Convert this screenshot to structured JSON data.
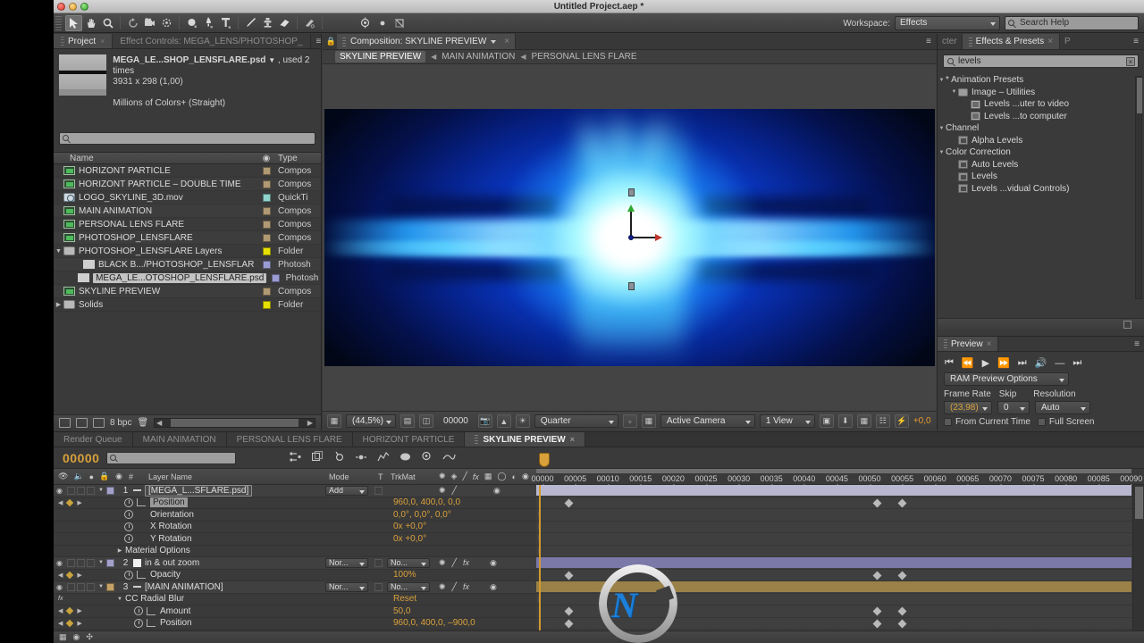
{
  "window": {
    "title": "Untitled Project.aep *"
  },
  "toolbar": {
    "tools": [
      {
        "name": "selection-tool",
        "glyph": "↖",
        "selected": true
      },
      {
        "name": "hand-tool",
        "glyph": "✋",
        "selected": false
      },
      {
        "name": "zoom-tool",
        "glyph": "⌕",
        "selected": false
      },
      {
        "name": "rotation-tool",
        "glyph": "↺",
        "selected": false
      },
      {
        "name": "camera-tool",
        "glyph": "▣",
        "selected": false
      },
      {
        "name": "pan-behind-tool",
        "glyph": "✣",
        "selected": false
      },
      {
        "name": "shape-tool",
        "glyph": "●",
        "selected": false
      },
      {
        "name": "pen-tool",
        "glyph": "✒",
        "selected": false
      },
      {
        "name": "text-tool",
        "glyph": "T",
        "selected": false
      },
      {
        "name": "brush-tool",
        "glyph": "╱",
        "selected": false
      },
      {
        "name": "clone-stamp-tool",
        "glyph": "⚒",
        "selected": false
      },
      {
        "name": "eraser-tool",
        "glyph": "▱",
        "selected": false
      },
      {
        "name": "roto-brush-tool",
        "glyph": "✄",
        "selected": false
      },
      {
        "name": "puppet-pin-tool",
        "glyph": "☉",
        "selected": false
      },
      {
        "name": "puppet-overlap-tool",
        "glyph": "●",
        "selected": false
      },
      {
        "name": "puppet-starch-tool",
        "glyph": "◩",
        "selected": false
      }
    ],
    "workspace_label": "Workspace:",
    "workspace_value": "Effects",
    "search_help_placeholder": "Search Help"
  },
  "project_panel": {
    "tabs": [
      {
        "label": "Project",
        "active": true,
        "closable": true
      },
      {
        "label": "Effect Controls: MEGA_LENS/PHOTOSHOP_",
        "active": false,
        "closable": false
      }
    ],
    "item_name": "MEGA_LE...SHOP_LENSFLARE.psd",
    "item_used": ", used 2 times",
    "item_dimensions": "3931 x 298 (1,00)",
    "item_colordepth": "Millions of Colors+ (Straight)",
    "search_placeholder": "",
    "columns": {
      "name": "Name",
      "tag": "tag-icon",
      "type": "Type"
    },
    "rows": [
      {
        "name": "HORIZONT PARTICLE",
        "type": "Compos",
        "icon": "comp-icon",
        "color": "#b09a73",
        "indent": 0,
        "twirl": "",
        "selected": false
      },
      {
        "name": "HORIZONT PARTICLE – DOUBLE TIME",
        "type": "Compos",
        "icon": "comp-icon",
        "color": "#b09a73",
        "indent": 0,
        "twirl": "",
        "selected": false
      },
      {
        "name": "LOGO_SKYLINE_3D.mov",
        "type": "QuickTi",
        "icon": "movie-icon",
        "color": "#8fd3cc",
        "indent": 0,
        "twirl": "",
        "selected": false
      },
      {
        "name": "MAIN ANIMATION",
        "type": "Compos",
        "icon": "comp-icon",
        "color": "#b09a73",
        "indent": 0,
        "twirl": "",
        "selected": false
      },
      {
        "name": "PERSONAL LENS FLARE",
        "type": "Compos",
        "icon": "comp-icon",
        "color": "#b09a73",
        "indent": 0,
        "twirl": "",
        "selected": false
      },
      {
        "name": "PHOTOSHOP_LENSFLARE",
        "type": "Compos",
        "icon": "comp-icon",
        "color": "#b09a73",
        "indent": 0,
        "twirl": "",
        "selected": false
      },
      {
        "name": "PHOTOSHOP_LENSFLARE Layers",
        "type": "Folder",
        "icon": "folder-icon",
        "color": "#e6e100",
        "indent": 0,
        "twirl": "▼",
        "selected": false
      },
      {
        "name": "BLACK B.../PHOTOSHOP_LENSFLARE.psd",
        "type": "Photosh",
        "icon": "psd-icon",
        "color": "#9b9bd4",
        "indent": 2,
        "twirl": "",
        "selected": false
      },
      {
        "name": "MEGA_LE...OTOSHOP_LENSFLARE.psd",
        "type": "Photosh",
        "icon": "psd-icon",
        "color": "#9b9bd4",
        "indent": 2,
        "twirl": "",
        "selected": true
      },
      {
        "name": "SKYLINE PREVIEW",
        "type": "Compos",
        "icon": "comp-icon",
        "color": "#b09a73",
        "indent": 0,
        "twirl": "",
        "selected": false
      },
      {
        "name": "Solids",
        "type": "Folder",
        "icon": "folder-icon",
        "color": "#e6e100",
        "indent": 0,
        "twirl": "▶",
        "selected": false
      }
    ],
    "footer": {
      "bit_depth": "8 bpc"
    }
  },
  "comp_panel": {
    "tab_label": "Composition: SKYLINE PREVIEW",
    "breadcrumb": [
      {
        "label": "SKYLINE PREVIEW",
        "current": true
      },
      {
        "label": "MAIN ANIMATION",
        "current": false
      },
      {
        "label": "PERSONAL LENS FLARE",
        "current": false
      }
    ],
    "footer": {
      "magnification": "(44,5%)",
      "timecode": "00000",
      "resolution": "Quarter",
      "camera": "Active Camera",
      "views": "1 View",
      "exposure": "+0,0"
    }
  },
  "effects_panel": {
    "tab_inactive_label": "cter",
    "tab_label": "Effects & Presets",
    "search_value": "levels",
    "tree": [
      {
        "label": "* Animation Presets",
        "depth": 0,
        "twirl": "▼",
        "icon": "none"
      },
      {
        "label": "Image – Utilities",
        "depth": 1,
        "twirl": "▼",
        "icon": "folder-icon"
      },
      {
        "label": "Levels ...uter to video",
        "depth": 2,
        "twirl": "",
        "icon": "preset-icon"
      },
      {
        "label": "Levels ...to computer",
        "depth": 2,
        "twirl": "",
        "icon": "preset-icon"
      },
      {
        "label": "Channel",
        "depth": 0,
        "twirl": "▼",
        "icon": "none"
      },
      {
        "label": "Alpha Levels",
        "depth": 1,
        "twirl": "",
        "icon": "effect-icon"
      },
      {
        "label": "Color Correction",
        "depth": 0,
        "twirl": "▼",
        "icon": "none"
      },
      {
        "label": "Auto Levels",
        "depth": 1,
        "twirl": "",
        "icon": "effect-icon"
      },
      {
        "label": "Levels",
        "depth": 1,
        "twirl": "",
        "icon": "effect-icon"
      },
      {
        "label": "Levels ...vidual Controls)",
        "depth": 1,
        "twirl": "",
        "icon": "effect-icon"
      }
    ]
  },
  "preview_panel": {
    "tab_label": "Preview",
    "transport": [
      {
        "name": "first-frame-button",
        "glyph": "⧏▏"
      },
      {
        "name": "previous-frame-button",
        "glyph": "◀❘"
      },
      {
        "name": "play-button",
        "glyph": "▶"
      },
      {
        "name": "next-frame-button",
        "glyph": "❘▶"
      },
      {
        "name": "last-frame-button",
        "glyph": "▶❙"
      },
      {
        "name": "audio-button",
        "glyph": "◂))"
      },
      {
        "name": "loop-button",
        "glyph": "→"
      },
      {
        "name": "ram-preview-button",
        "glyph": "❘▶"
      }
    ],
    "options_label": "RAM Preview Options",
    "frame_rate_label": "Frame Rate",
    "frame_rate_value": "(23,98)",
    "skip_label": "Skip",
    "skip_value": "0",
    "resolution_label": "Resolution",
    "resolution_value": "Auto",
    "from_current_time": "From Current Time",
    "full_screen": "Full Screen"
  },
  "timeline": {
    "tabs": [
      {
        "label": "Render Queue",
        "active": false
      },
      {
        "label": "MAIN ANIMATION",
        "active": false
      },
      {
        "label": "PERSONAL LENS FLARE",
        "active": false
      },
      {
        "label": "HORIZONT PARTICLE",
        "active": false
      },
      {
        "label": "SKYLINE PREVIEW",
        "active": true
      }
    ],
    "current_time": "00000",
    "search_placeholder": "",
    "columns": {
      "layer_name": "Layer Name",
      "mode": "Mode",
      "t": "T",
      "trkmat": "TrkMat"
    },
    "ruler_ticks": [
      "00000",
      "00005",
      "00010",
      "00015",
      "00020",
      "00025",
      "00030",
      "00035",
      "00040",
      "00045",
      "00050",
      "00055",
      "00060",
      "00065",
      "00070",
      "00075",
      "00080",
      "00085",
      "00090"
    ],
    "rows": [
      {
        "kind": "layer",
        "index": "1",
        "name": "[MEGA_L...SFLARE.psd]",
        "mode": "Add",
        "trkmat": "",
        "color": "#a3a1c9",
        "value": "",
        "bar_color": "#b8b7cf",
        "selected": true
      },
      {
        "kind": "prop",
        "indent": 3,
        "name": "Position",
        "value": "960,0, 400,0, 0,0",
        "selected": true,
        "has_keyframes": true,
        "stopwatch": true
      },
      {
        "kind": "prop",
        "indent": 3,
        "name": "Orientation",
        "value": "0,0°, 0,0°, 0,0°",
        "selected": false,
        "has_keyframes": false,
        "stopwatch": true
      },
      {
        "kind": "prop",
        "indent": 3,
        "name": "X Rotation",
        "value": "0x +0,0°",
        "selected": false,
        "has_keyframes": false,
        "stopwatch": true
      },
      {
        "kind": "prop",
        "indent": 3,
        "name": "Y Rotation",
        "value": "0x +0,0°",
        "selected": false,
        "has_keyframes": false,
        "stopwatch": true
      },
      {
        "kind": "group",
        "indent": 2,
        "name": "Material Options",
        "value": "",
        "twirl": "▶"
      },
      {
        "kind": "layer",
        "index": "2",
        "name": "in & out zoom",
        "mode": "Nor...",
        "trkmat": "No...",
        "color": "#a3a1c9",
        "value": "",
        "bar_color": "#7a79a8",
        "selected": false,
        "solid": true
      },
      {
        "kind": "prop",
        "indent": 3,
        "name": "Opacity",
        "value": "100%",
        "selected": false,
        "has_keyframes": true,
        "stopwatch": true
      },
      {
        "kind": "layer",
        "index": "3",
        "name": "[MAIN ANIMATION]",
        "mode": "Nor...",
        "trkmat": "No...",
        "color": "#c5a367",
        "value": "",
        "bar_color": "#9a8148",
        "selected": false
      },
      {
        "kind": "effect",
        "indent": 2,
        "name": "CC Radial Blur",
        "value": "Reset",
        "twirl": "▼"
      },
      {
        "kind": "prop",
        "indent": 4,
        "name": "Amount",
        "value": "50,0",
        "selected": false,
        "has_keyframes": true,
        "stopwatch": true
      },
      {
        "kind": "prop",
        "indent": 4,
        "name": "Position",
        "value": "960,0, 400,0, –900,0",
        "selected": false,
        "has_keyframes": true,
        "stopwatch": true
      }
    ]
  }
}
